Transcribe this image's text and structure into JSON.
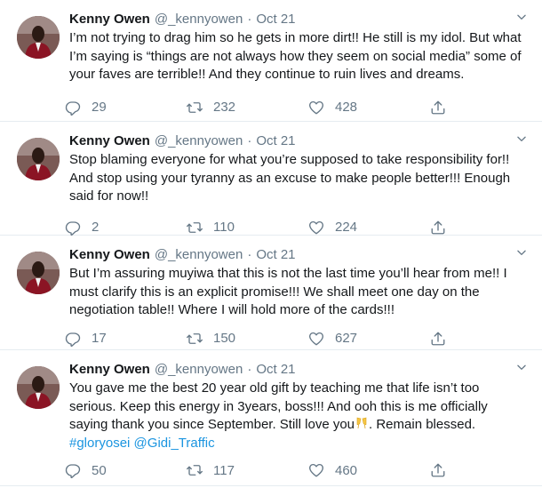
{
  "tweets": [
    {
      "name": "Kenny Owen",
      "handle": "@_kennyowen",
      "dot": "·",
      "date": "Oct 21",
      "text": "I’m not trying to drag him so he gets in more dirt!! He still is my idol. But what I’m saying is “things are not always how they seem on social media” some of your faves are terrible!! And they continue to ruin lives and dreams.",
      "replies": "29",
      "retweets": "232",
      "likes": "428"
    },
    {
      "name": "Kenny Owen",
      "handle": "@_kennyowen",
      "dot": "·",
      "date": "Oct 21",
      "text": "Stop blaming everyone for what you’re supposed to take responsibility for!! And stop using your tyranny as an excuse to make people better!!! Enough said for now!!",
      "replies": "2",
      "retweets": "110",
      "likes": "224"
    },
    {
      "name": "Kenny Owen",
      "handle": "@_kennyowen",
      "dot": "·",
      "date": "Oct 21",
      "text": "But I’m assuring muyiwa that this is not the last time you’ll hear from me!! I must clarify this is an explicit promise!!! We shall meet one day on the negotiation table!! Where I will hold more of the cards!!!",
      "replies": "17",
      "retweets": "150",
      "likes": "627"
    },
    {
      "name": "Kenny Owen",
      "handle": "@_kennyowen",
      "dot": "·",
      "date": "Oct 21",
      "text_before_emoji": "You gave me the best 20 year old gift by teaching me that life isn’t too serious. Keep this energy in 3years, boss!!! And ooh this is me officially saying thank you since September. Still love you",
      "emoji_icon": "clinking-glasses-icon",
      "text_after_emoji": ". Remain blessed.",
      "hashtag": "#gloryosei",
      "mention": "@Gidi_Traffic",
      "replies": "50",
      "retweets": "117",
      "likes": "460"
    }
  ],
  "colors": {
    "text": "#14171a",
    "secondary": "#657786",
    "link": "#1b95e0",
    "divider": "#e6ecf0"
  }
}
